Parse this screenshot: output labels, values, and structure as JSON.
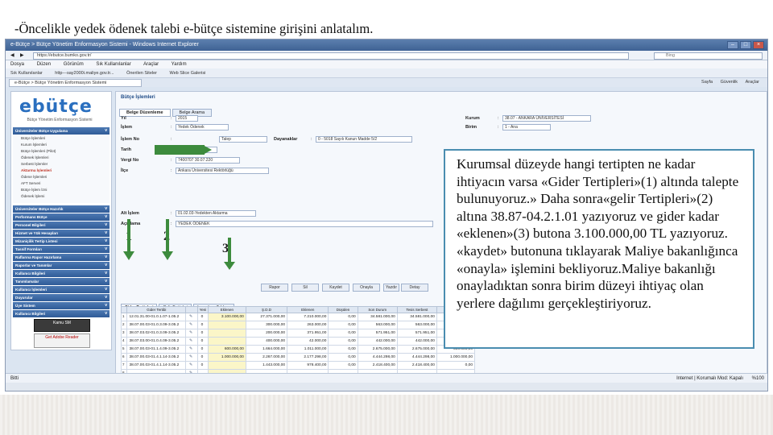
{
  "slide": {
    "heading": "-Öncelikle yedek ödenek talebi e-bütçe sistemine girişini anlatalım."
  },
  "browser": {
    "window_title": "e-Bütçe > Bütçe Yönetim Enformasyon Sistemi - Windows Internet Explorer",
    "address": "https://ebutce.bumko.gov.tr/",
    "search_placeholder": "Bing",
    "menu": [
      "Dosya",
      "Düzen",
      "Görünüm",
      "Sık Kullanılanlar",
      "Araçlar",
      "Yardım"
    ],
    "favorites": [
      "Sık Kullanılanlar",
      "http---say2000i.maliye.gov.tr...",
      "Önerilen Siteler",
      "Web Slice Galerisi"
    ],
    "tab_label": "e-Bütçe > Bütçe Yönetim Enformasyon Sistemi",
    "tools": [
      "Sayfa",
      "Güvenlik",
      "Araçlar"
    ],
    "status_left": "Bitti",
    "status_right": "Internet | Korumalı Mod: Kapalı",
    "zoom": "%100"
  },
  "leftnav": {
    "logo": "ebütçe",
    "logo_subtitle": "Bütçe Yönetim Enformasyon Sistemi",
    "sections": [
      "Üniversiteler Bütçe Uygulama",
      "Üniversiteler Bütçe Hazırlık",
      "Performans Bütçe",
      "Personel Bilgileri",
      "Hizmet ve Yük Hesapları",
      "Mizaniçilik Tertip Listesi",
      "Tasnif Formları",
      "Raflarına Rapor Hazırlama",
      "Raporlar ve Tanımlar",
      "Kullanıcı Bilgileri",
      "Tanımlamalar",
      "Kullanıcı İşlemleri",
      "Duyurular",
      "Üye Sistem",
      "Kullanıcı Bilgileri"
    ],
    "sub_items": [
      "Bütçe İşlemleri",
      "Kurum İşlemleri",
      "Bütçe İşlemleri (Pilot)",
      "Ödenek İşlemleri",
      "Serbest İşlemler",
      "Aktarma İşlemleri",
      "Ödene İşlemleri",
      "AFT Serveri",
      "Bütçe İşlem İzni",
      "Ödenek İşlemi"
    ],
    "highlight_index": 5,
    "banners": [
      "Kamu SM",
      "Get Adobe Reader"
    ]
  },
  "main": {
    "title": "Bütçe İşlemleri",
    "tabs": [
      "Belge Düzenleme",
      "Belge Arama"
    ],
    "active_tab": 0,
    "form": {
      "yil_label": "Yıl",
      "yil_value": "2015",
      "islem_label": "İşlem",
      "islem_value": "Yedek Ödenek",
      "kurum_label": "Kurum",
      "kurum_value": "38.07 - ANKARA ÜNİVERSİTESİ",
      "birim_label": "Birim",
      "birim_value": "1 - Ana",
      "islem_no_label": "İşlem No",
      "islem_no_value": "Talep",
      "dayanak_label": "Dayanaklar",
      "dayanak_value": "0 - 5018 Sayılı Kanun Madde 5/2",
      "tarih_label": "Tarih",
      "tarih_value": "20.11.2015",
      "vergi_label": "Vergi No",
      "vergi_value": "7400707 30.07.220",
      "ilce_label": "İlçe",
      "ilce_value": "Ankara Üniversitesi Rektörlüğü",
      "alt_islem_label": "Alt İşlem",
      "alt_islem_value": "01.02.03-Yedekten Aktarma",
      "aciklama_label": "Açıklama",
      "aciklama_value": "YEDEK ÖDENEK"
    },
    "actions": [
      "Detay",
      "Kaydet",
      "Onayla",
      "Sil",
      "Yazdır",
      "Rapor"
    ],
    "subtabs": [
      "Gider Tertipleri",
      "Gelir Tertipleri",
      "Logaritma Tablosu"
    ],
    "active_subtab": 0,
    "grid": {
      "headers": [
        "",
        "Gider Tertibi",
        "",
        "Yeni",
        "Eklenen",
        "Ş.D.D",
        "Eklenen",
        "Düşülen",
        "Son Durum",
        "Tesis Serbest",
        "Tesis Serbest"
      ],
      "rows": [
        {
          "n": "1",
          "tertip": "12.01.31.00-01.0.1.07-1.05.2",
          "yeni": "0",
          "eklenen": "3.100.000,00",
          "sdd": "27.371.000,00",
          "ek2": "7.210.000,00",
          "dus": "0,00",
          "son": "34.581.000,00",
          "ts1": "34.581.000,00",
          "ts2": "3.100.000,00"
        },
        {
          "n": "2",
          "tertip": "38.07.00.03-01.0.3.09-3.05.2",
          "yeni": "0",
          "eklenen": "",
          "sdd": "300.000,00",
          "ek2": "263.000,00",
          "dus": "0,00",
          "son": "563.000,00",
          "ts1": "563.000,00",
          "ts2": "0,00"
        },
        {
          "n": "3",
          "tertip": "38.07.03.02-01.0.3.09-3.05.2",
          "yeni": "0",
          "eklenen": "",
          "sdd": "200.000,00",
          "ek2": "371.951,00",
          "dus": "0,00",
          "son": "571.951,00",
          "ts1": "571.951,00",
          "ts2": "0,00"
        },
        {
          "n": "4",
          "tertip": "38.07.03.00-01.0.4.09-3.05.2",
          "yeni": "0",
          "eklenen": "",
          "sdd": "400.000,00",
          "ek2": "42.000,00",
          "dus": "0,00",
          "son": "442.000,00",
          "ts1": "442.000,00",
          "ts2": "0,00"
        },
        {
          "n": "5",
          "tertip": "38.07.00.03-01.1.4.09-3.05.2",
          "yeni": "0",
          "eklenen": "600.000,00",
          "sdd": "1.664.000,00",
          "ek2": "1.011.000,00",
          "dus": "0,00",
          "son": "2.675.000,00",
          "ts1": "2.675.000,00",
          "ts2": "600.000,00"
        },
        {
          "n": "6",
          "tertip": "38.07.00.03-01.4.1.14-3.05.2",
          "yeni": "0",
          "eklenen": "1.000.000,00",
          "sdd": "2.267.000,00",
          "ek2": "2.177.298,00",
          "dus": "0,00",
          "son": "4.444.298,00",
          "ts1": "4.444.298,00",
          "ts2": "1.000.000,00"
        },
        {
          "n": "7",
          "tertip": "38.07.00.03-01.4.1.14-3.05.2",
          "yeni": "0",
          "eklenen": "",
          "sdd": "1.443.000,00",
          "ek2": "978.400,00",
          "dus": "0,00",
          "son": "2.418.400,00",
          "ts1": "2.418.400,00",
          "ts2": "0,00"
        },
        {
          "n": "8"
        },
        {
          "n": "9"
        },
        {
          "n": "10"
        },
        {
          "n": "11"
        },
        {
          "n": "12"
        },
        {
          "n": "13"
        }
      ]
    }
  },
  "annotations": {
    "labels": [
      "1",
      "2",
      "3"
    ],
    "arrow_color": "#3d8b3d"
  },
  "callout": {
    "text": "Kurumsal düzeyde hangi tertipten ne kadar ihtiyacın varsa «Gider Tertipleri»(1) altında talepte bulunuyoruz.» Daha sonra«gelir Tertipleri»(2) altına 38.87-04.2.1.01 yazıyoruz ve gider kadar «eklenen»(3) butona 3.100.000,00 TL yazıyoruz. «kaydet» butonuna tıklayarak Maliye bakanlığınca «onayla» işlemini bekliyoruz.Maliye bakanlığı onayladıktan sonra birim düzeyi ihtiyaç olan yerlere dağılımı gerçekleştiriyoruz.",
    "border_color": "#4a8db0"
  }
}
